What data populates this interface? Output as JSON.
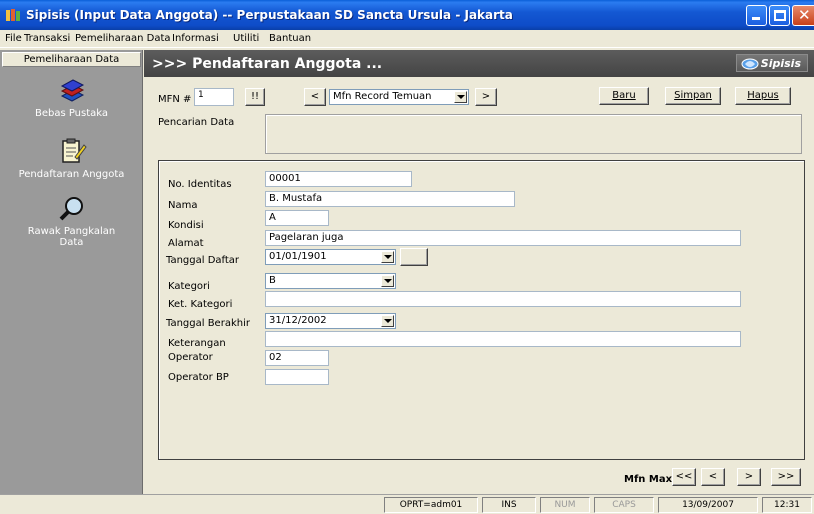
{
  "window": {
    "title": "Sipisis (Input Data Anggota) -- Perpustakaan SD Sancta Ursula - Jakarta",
    "icon": "books-app-icon"
  },
  "menu": [
    {
      "label": "File"
    },
    {
      "label": "Transaksi"
    },
    {
      "label": "Pemeliharaan Data"
    },
    {
      "label": "Informasi"
    },
    {
      "label": "Utiliti"
    },
    {
      "label": "Bantuan"
    }
  ],
  "sidebar": {
    "header": "Pemeliharaan Data",
    "items": [
      {
        "label": "Bebas Pustaka",
        "icon": "books-stack-icon"
      },
      {
        "label": "Pendaftaran Anggota",
        "icon": "clipboard-pencil-icon"
      },
      {
        "label": "Rawak Pangkalan Data",
        "label_line1": "Rawak Pangkalan",
        "label_line2": "Data",
        "icon": "magnifier-icon"
      }
    ]
  },
  "header": {
    "title": ">>> Pendaftaran Anggota ...",
    "brand": "Sipisis"
  },
  "toolbar": {
    "mfn_label": "MFN #",
    "mfn_value": "1",
    "goto_label": "!!",
    "prev_label": "<",
    "record_select": "Mfn Record Temuan",
    "next_label": ">",
    "baru_label": "Baru",
    "simpan_label": "Simpan",
    "hapus_label": "Hapus"
  },
  "search": {
    "label": "Pencarian Data",
    "value": ""
  },
  "form": {
    "no_identitas": {
      "label": "No. Identitas",
      "value": "00001"
    },
    "nama": {
      "label": "Nama",
      "value": "B. Mustafa"
    },
    "kondisi": {
      "label": "Kondisi",
      "value": "A"
    },
    "alamat": {
      "label": "Alamat",
      "value": "Pagelaran juga"
    },
    "tanggal_daftar": {
      "label": "Tanggal Daftar",
      "value": "01/01/1901"
    },
    "kategori": {
      "label": "Kategori",
      "value": "B"
    },
    "ket_kategori": {
      "label": "Ket. Kategori",
      "value": ""
    },
    "tanggal_berakhir": {
      "label": "Tanggal Berakhir",
      "value": "31/12/2002"
    },
    "keterangan": {
      "label": "Keterangan",
      "value": ""
    },
    "operator": {
      "label": "Operator",
      "value": "02"
    },
    "operator_bp": {
      "label": "Operator BP",
      "value": ""
    }
  },
  "nav": {
    "mfn_max_label": "Mfn Max",
    "first": "<<",
    "prev": "<",
    "next": ">",
    "last": ">>"
  },
  "status": {
    "operator": "OPRT=adm01",
    "ins": "INS",
    "num": "NUM",
    "caps": "CAPS",
    "date": "13/09/2007",
    "time": "12:31"
  },
  "colors": {
    "titlebar": "#1458d3",
    "sidebar": "#9a9a9a",
    "header_band": "#505050",
    "face": "#ece9d8"
  }
}
